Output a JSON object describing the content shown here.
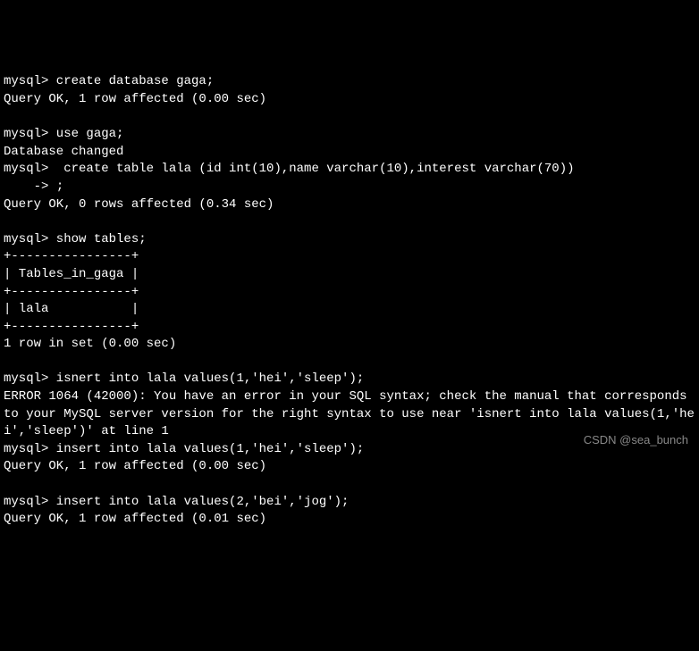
{
  "terminal": {
    "lines": [
      "mysql> create database gaga;",
      "Query OK, 1 row affected (0.00 sec)",
      "",
      "mysql> use gaga;",
      "Database changed",
      "mysql>  create table lala (id int(10),name varchar(10),interest varchar(70))",
      "    -> ;",
      "Query OK, 0 rows affected (0.34 sec)",
      "",
      "mysql> show tables;",
      "+----------------+",
      "| Tables_in_gaga |",
      "+----------------+",
      "| lala           |",
      "+----------------+",
      "1 row in set (0.00 sec)",
      "",
      "mysql> isnert into lala values(1,'hei','sleep');",
      "ERROR 1064 (42000): You have an error in your SQL syntax; check the manual that corresponds to your MySQL server version for the right syntax to use near 'isnert into lala values(1,'hei','sleep')' at line 1",
      "mysql> insert into lala values(1,'hei','sleep');",
      "Query OK, 1 row affected (0.00 sec)",
      "",
      "mysql> insert into lala values(2,'bei','jog');",
      "Query OK, 1 row affected (0.01 sec)"
    ]
  },
  "watermark": "CSDN @sea_bunch"
}
